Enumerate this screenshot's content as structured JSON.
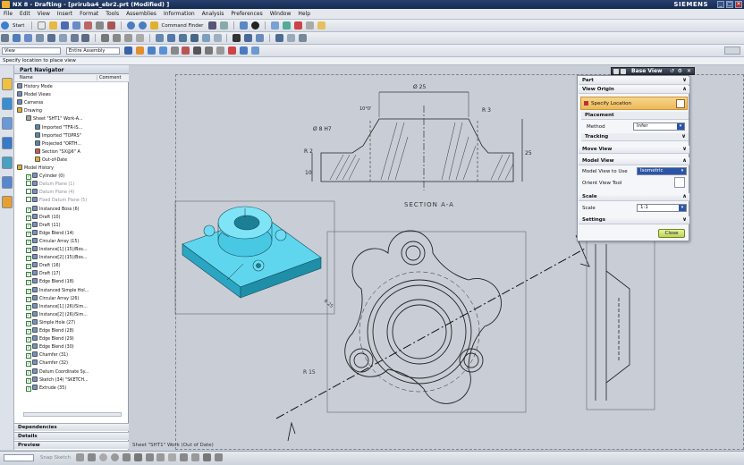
{
  "window": {
    "title": "NX 8 - Drafting - [priruba4_ebr2.prt (Modified) ]",
    "brand": "SIEMENS",
    "controls": [
      "_",
      "□",
      "✕"
    ]
  },
  "menu": [
    "File",
    "Edit",
    "View",
    "Insert",
    "Format",
    "Tools",
    "Assemblies",
    "Information",
    "Analysis",
    "Preferences",
    "Window",
    "Help"
  ],
  "toolbar": {
    "start_label": "Start",
    "command_finder": "Command Finder"
  },
  "selection": {
    "filter": "View",
    "scope": "Entire Assembly"
  },
  "cue": "Specify location to place view",
  "navigator": {
    "title": "Part Navigator",
    "col_name": "Name",
    "col_comment": "Comment",
    "rows": [
      "History Mode",
      "Model Views",
      "Cameras",
      "Drawing",
      "Sheet \"SHT1\" Work-A...",
      "Imported \"TFR-IS...",
      "Imported \"TOPRS\"",
      "Projected \"ORTH...",
      "Section \"SX@6\" A",
      "Out-of-Date",
      "Model History",
      "Cylinder (0)",
      "Datum Plane (1)",
      "Datum Plane (4)",
      "Fixed Datum Plane (5)",
      "Instanced Boss (6)",
      "Draft (10)",
      "Draft (11)",
      "Edge Blend (14)",
      "Circular Array (15)",
      "Instance[1] (15)/Bos...",
      "Instance[2] (15)/Bos...",
      "Draft (16)",
      "Draft (17)",
      "Edge Blend (18)",
      "Instanced Simple Hol...",
      "Circular Array (26)",
      "Instance[1] (26)/Sim...",
      "Instance[2] (26)/Sim...",
      "Simple Hole (27)",
      "Edge Blend (28)",
      "Edge Blend (29)",
      "Edge Blend (30)",
      "Chamfer (31)",
      "Chamfer (32)",
      "Datum Coordinate Sy...",
      "Sketch (34) \"SKETCH...",
      "Extrude (35)"
    ],
    "panels": [
      "Dependencies",
      "Details",
      "Preview"
    ]
  },
  "drawing": {
    "dims": {
      "d25": "Ø 25",
      "d8": "Ø 8 H7",
      "r2": "R 2",
      "d10": "10",
      "d25v": "25",
      "r15": "R 15",
      "ch": "10°0'",
      "r3": "R 3"
    },
    "section_label": "SECTION A-A",
    "r15_plan": "R 15",
    "r25_plan": "R 25"
  },
  "status": "Sheet \"SHT1\" Work (Out of Date)",
  "dialog": {
    "title": "Base View",
    "part": "Part",
    "view_origin": "View Origin",
    "specify_location": "Specify Location",
    "placement": "Placement",
    "method_label": "Method",
    "method_value": "Infer",
    "tracking": "Tracking",
    "move_view": "Move View",
    "model_view": "Model View",
    "model_view_to_use": "Model View to Use",
    "model_view_value": "Isometric",
    "orient_view_tool": "Orient View Tool",
    "scale": "Scale",
    "scale_label": "Scale",
    "scale_value": "1:1",
    "settings": "Settings",
    "close": "Close"
  },
  "bottom": {
    "snap_label": "Snap Sketch"
  },
  "colors": {
    "accent": "#2b54a8",
    "model": "#3cc6e0",
    "highlight": "#f3c773"
  }
}
